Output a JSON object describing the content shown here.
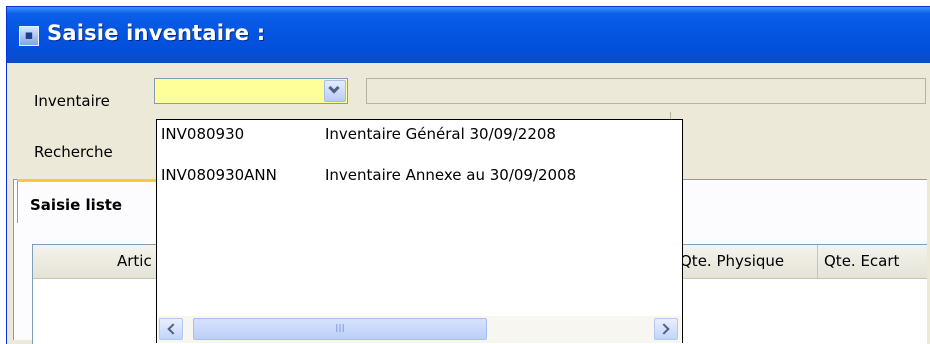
{
  "window": {
    "title": "Saisie inventaire :",
    "icon": "app-icon"
  },
  "form": {
    "inventaire_label": "Inventaire",
    "inventaire_value": "",
    "recherche_label": "Recherche"
  },
  "tabs": [
    {
      "label": "Saisie liste",
      "active": true
    }
  ],
  "grid": {
    "columns": [
      "Artic",
      "Qte. Physique",
      "Qte. Ecart"
    ]
  },
  "dropdown": {
    "items": [
      {
        "code": "INV080930",
        "description": "Inventaire Général 30/09/2208"
      },
      {
        "code": "INV080930ANN",
        "description": "Inventaire Annexe au 30/09/2008"
      }
    ],
    "scroll_thumb_grip": "III"
  },
  "colors": {
    "title_bar": "#0656e4",
    "combo_background": "#ffff99",
    "active_tab_accent": "#ffc83c",
    "window_background": "#ece9d8"
  }
}
